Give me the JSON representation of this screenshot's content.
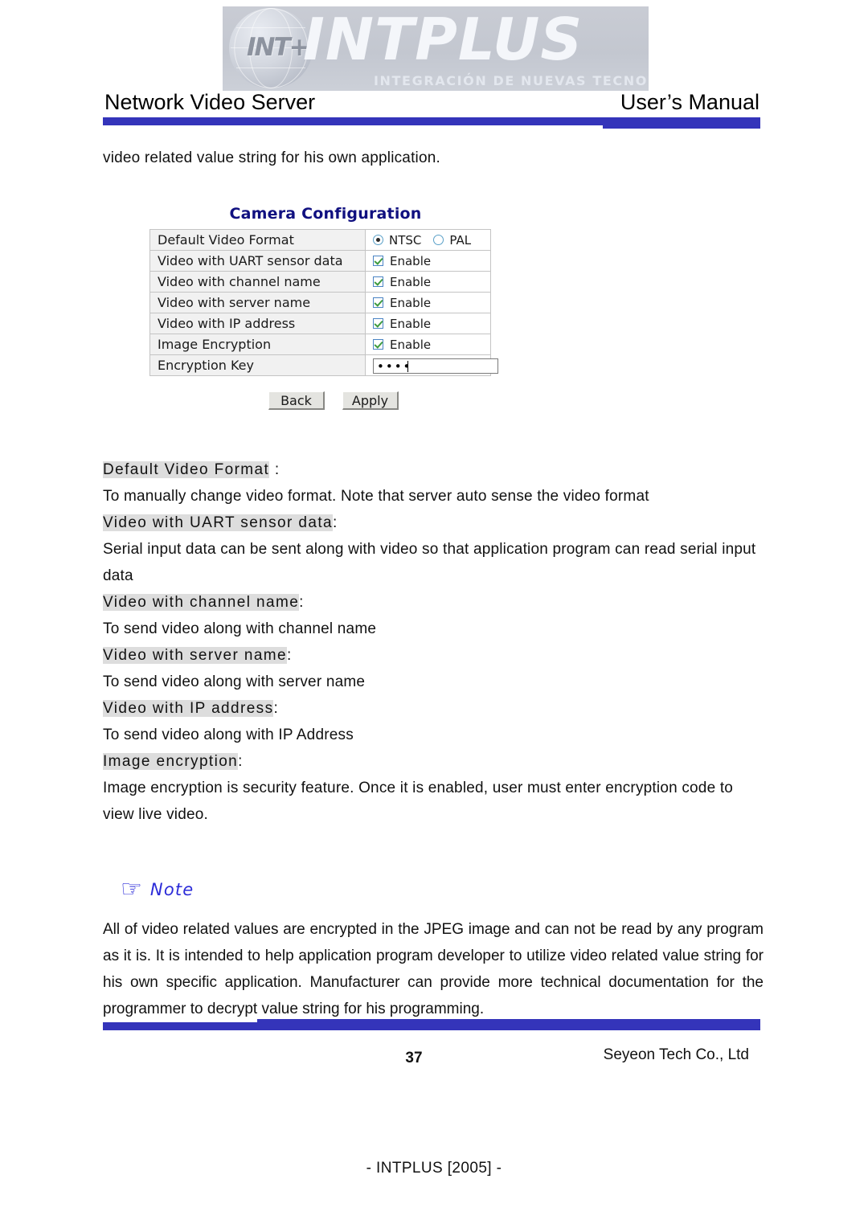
{
  "header": {
    "logo_mark": "INT+",
    "logo_word": "INTPLUS",
    "logo_tagline": "INTEGRACIÓN  DE  NUEVAS  TECNOLOGÍAS",
    "left_title": "Network Video Server",
    "right_title": "User’s Manual",
    "rule_color": "#3434ba"
  },
  "intro": {
    "line": "video related value string for his own application."
  },
  "form": {
    "title": "Camera Configuration",
    "title_color": "#101080",
    "rows": [
      {
        "label": "Default Video Format",
        "control": "radio",
        "options": [
          {
            "label": "NTSC",
            "selected": true
          },
          {
            "label": "PAL",
            "selected": false
          }
        ]
      },
      {
        "label": "Video with UART sensor data",
        "control": "checkbox",
        "value_label": "Enable",
        "checked": true
      },
      {
        "label": "Video with channel name",
        "control": "checkbox",
        "value_label": "Enable",
        "checked": true
      },
      {
        "label": "Video with server name",
        "control": "checkbox",
        "value_label": "Enable",
        "checked": true
      },
      {
        "label": "Video with IP address",
        "control": "checkbox",
        "value_label": "Enable",
        "checked": true
      },
      {
        "label": "Image Encryption",
        "control": "checkbox",
        "value_label": "Enable",
        "checked": true
      },
      {
        "label": "Encryption Key",
        "control": "password",
        "value": "••••"
      }
    ],
    "buttons": {
      "back": "Back",
      "apply": "Apply"
    }
  },
  "definitions": [
    {
      "term": "Default Video Format",
      "term_suffix": " :",
      "desc": "To manually change video format. Note that server auto sense the video format"
    },
    {
      "term": "Video with UART sensor data",
      "term_suffix": ":",
      "desc": "Serial input data can be sent along with video so that application program can read serial input data"
    },
    {
      "term": "Video with channel name",
      "term_suffix": ":",
      "desc": "To send video along with channel name"
    },
    {
      "term": "Video with server name",
      "term_suffix": ":",
      "desc": "To send video along with server name"
    },
    {
      "term": "Video with IP address",
      "term_suffix": ":",
      "desc": "To send video along with IP Address"
    },
    {
      "term": "Image encryption",
      "term_suffix": ":",
      "desc": "Image encryption is security feature. Once it is enabled, user must enter encryption code to view live video."
    }
  ],
  "note": {
    "icon": "☞",
    "label": "Note",
    "color": "#2b2bd8",
    "body": "All of video related values are encrypted in the JPEG image and can not be read by any program as it is. It is intended to help application program developer to utilize video related value string for his own specific application. Manufacturer can provide more technical documentation for the programmer to decrypt value string for his programming."
  },
  "footer": {
    "page_number": "37",
    "company": "Seyeon Tech Co., Ltd",
    "imprint": "- INTPLUS [2005] -"
  }
}
